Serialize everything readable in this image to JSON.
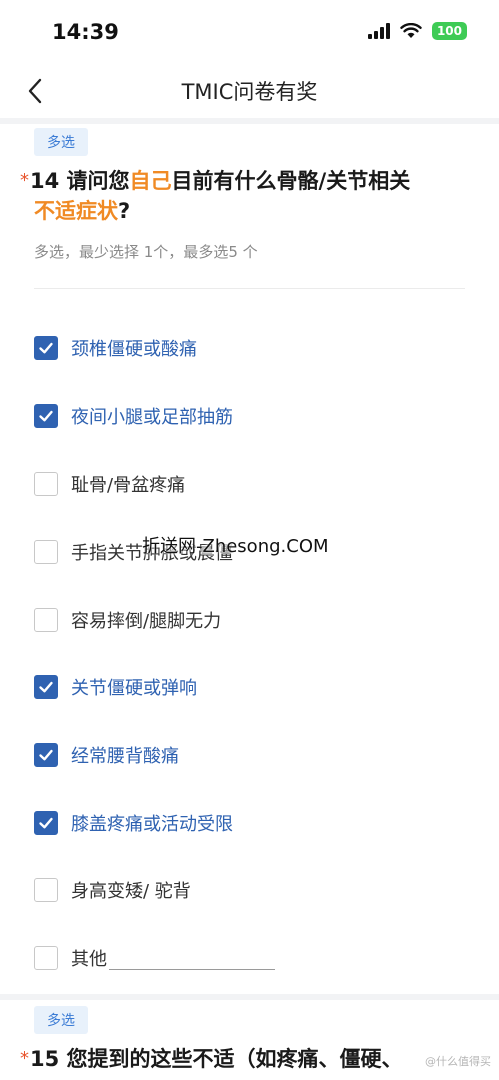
{
  "status": {
    "time": "14:39",
    "battery": "100"
  },
  "header": {
    "title": "TMIC问卷有奖"
  },
  "q14": {
    "tag": "多选",
    "required_mark": "*",
    "num_prefix": "14 请问您",
    "hl1": "自己",
    "mid": "目前有什么骨骼/关节相关",
    "hl2": "不适症状",
    "end": "?",
    "hint": "多选，最少选择 1个，最多选5 个",
    "options": [
      {
        "label": "颈椎僵硬或酸痛",
        "checked": true
      },
      {
        "label": "夜间小腿或足部抽筋",
        "checked": true
      },
      {
        "label": "耻骨/骨盆疼痛",
        "checked": false
      },
      {
        "label": "手指关节肿胀或晨僵",
        "checked": false
      },
      {
        "label": "容易摔倒/腿脚无力",
        "checked": false
      },
      {
        "label": "关节僵硬或弹响",
        "checked": true
      },
      {
        "label": "经常腰背酸痛",
        "checked": true
      },
      {
        "label": "膝盖疼痛或活动受限",
        "checked": true
      },
      {
        "label": "身高变矮/ 驼背",
        "checked": false
      },
      {
        "label": "其他",
        "checked": false
      }
    ]
  },
  "q15": {
    "tag": "多选",
    "required_mark": "*",
    "title": "15 您提到的这些不适（如疼痛、僵硬、"
  },
  "watermark": "折送网-Zhesong.COM",
  "watermark2": "@什么值得买"
}
